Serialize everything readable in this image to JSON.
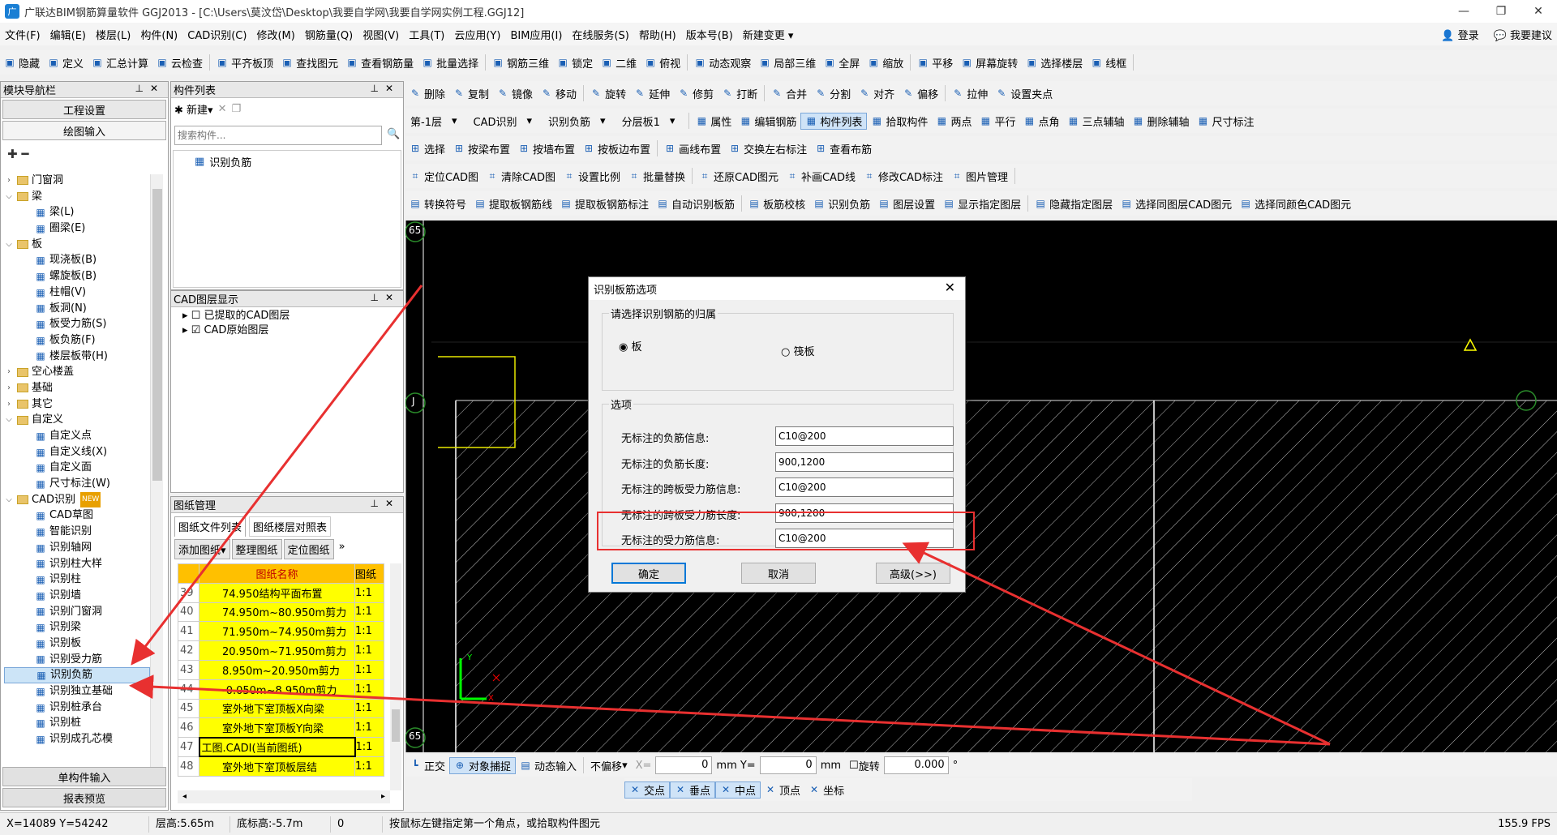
{
  "window": {
    "title": "广联达BIM钢筋算量软件 GGJ2013 - [C:\\Users\\莫汶岱\\Desktop\\我要自学网\\我要自学网实例工程.GGJ12]",
    "min": "—",
    "max": "❐",
    "close": "✕",
    "app_icon": "logo-icon"
  },
  "menu": {
    "items": [
      "文件(F)",
      "编辑(E)",
      "楼层(L)",
      "构件(N)",
      "CAD识别(C)",
      "修改(M)",
      "钢筋量(Q)",
      "视图(V)",
      "工具(T)",
      "云应用(Y)",
      "BIM应用(I)",
      "在线服务(S)",
      "帮助(H)",
      "版本号(B)",
      "新建变更 ▾"
    ],
    "login": "登录",
    "suggest": "我要建议"
  },
  "toolbar1": [
    "隐藏",
    "定义",
    "汇总计算",
    "云检查",
    "平齐板顶",
    "查找图元",
    "查看钢筋量",
    "批量选择",
    "钢筋三维",
    "锁定",
    "二维",
    "俯视",
    "动态观察",
    "局部三维",
    "全屏",
    "缩放",
    "平移",
    "屏幕旋转",
    "选择楼层",
    "线框"
  ],
  "toolbar2": [
    "删除",
    "复制",
    "镜像",
    "移动",
    "旋转",
    "延伸",
    "修剪",
    "打断",
    "合并",
    "分割",
    "对齐",
    "偏移",
    "拉伸",
    "设置夹点"
  ],
  "toolbar3": {
    "floor": "第-1层",
    "type": "CAD识别",
    "comp": "识别负筋",
    "layer": "分层板1",
    "items": [
      "属性",
      "编辑钢筋",
      "构件列表",
      "拾取构件",
      "两点",
      "平行",
      "点角",
      "三点辅轴",
      "删除辅轴",
      "尺寸标注"
    ]
  },
  "toolbar4": [
    "选择",
    "按梁布置",
    "按墙布置",
    "按板边布置",
    "画线布置",
    "交换左右标注",
    "查看布筋"
  ],
  "toolbar5": [
    "定位CAD图",
    "清除CAD图",
    "设置比例",
    "批量替换",
    "还原CAD图元",
    "补画CAD线",
    "修改CAD标注",
    "图片管理"
  ],
  "toolbar6": [
    "转换符号",
    "提取板钢筋线",
    "提取板钢筋标注",
    "自动识别板筋",
    "板筋校核",
    "识别负筋",
    "图层设置",
    "显示指定图层",
    "隐藏指定图层",
    "选择同图层CAD图元",
    "选择同颜色CAD图元"
  ],
  "nav": {
    "title": "模块导航栏",
    "btn1": "工程设置",
    "btn2": "绘图输入",
    "btn3": "单构件输入",
    "btn4": "报表预览",
    "tree": [
      {
        "l": "门窗洞",
        "lvl": 0,
        "f": true,
        "e": ">"
      },
      {
        "l": "梁",
        "lvl": 0,
        "f": true,
        "e": "v"
      },
      {
        "l": "梁(L)",
        "lvl": 1
      },
      {
        "l": "圈梁(E)",
        "lvl": 1
      },
      {
        "l": "板",
        "lvl": 0,
        "f": true,
        "e": "v"
      },
      {
        "l": "现浇板(B)",
        "lvl": 1
      },
      {
        "l": "螺旋板(B)",
        "lvl": 1
      },
      {
        "l": "柱帽(V)",
        "lvl": 1
      },
      {
        "l": "板洞(N)",
        "lvl": 1
      },
      {
        "l": "板受力筋(S)",
        "lvl": 1
      },
      {
        "l": "板负筋(F)",
        "lvl": 1
      },
      {
        "l": "楼层板带(H)",
        "lvl": 1
      },
      {
        "l": "空心楼盖",
        "lvl": 0,
        "f": true,
        "e": ">"
      },
      {
        "l": "基础",
        "lvl": 0,
        "f": true,
        "e": ">"
      },
      {
        "l": "其它",
        "lvl": 0,
        "f": true,
        "e": ">"
      },
      {
        "l": "自定义",
        "lvl": 0,
        "f": true,
        "e": "v"
      },
      {
        "l": "自定义点",
        "lvl": 1
      },
      {
        "l": "自定义线(X)",
        "lvl": 1
      },
      {
        "l": "自定义面",
        "lvl": 1
      },
      {
        "l": "尺寸标注(W)",
        "lvl": 1
      },
      {
        "l": "CAD识别",
        "lvl": 0,
        "f": true,
        "e": "v",
        "new": "NEW"
      },
      {
        "l": "CAD草图",
        "lvl": 1
      },
      {
        "l": "智能识别",
        "lvl": 1
      },
      {
        "l": "识别轴网",
        "lvl": 1
      },
      {
        "l": "识别柱大样",
        "lvl": 1
      },
      {
        "l": "识别柱",
        "lvl": 1
      },
      {
        "l": "识别墙",
        "lvl": 1
      },
      {
        "l": "识别门窗洞",
        "lvl": 1
      },
      {
        "l": "识别梁",
        "lvl": 1
      },
      {
        "l": "识别板",
        "lvl": 1
      },
      {
        "l": "识别受力筋",
        "lvl": 1
      },
      {
        "l": "识别负筋",
        "lvl": 1,
        "sel": true
      },
      {
        "l": "识别独立基础",
        "lvl": 1
      },
      {
        "l": "识别桩承台",
        "lvl": 1
      },
      {
        "l": "识别桩",
        "lvl": 1
      },
      {
        "l": "识别成孔芯模",
        "lvl": 1
      }
    ]
  },
  "complist": {
    "title": "构件列表",
    "new_btn": "新建",
    "search_ph": "搜索构件...",
    "item": "识别负筋"
  },
  "cadlayer": {
    "title": "CAD图层显示",
    "items": [
      "已提取的CAD图层",
      "CAD原始图层"
    ]
  },
  "drawings": {
    "title": "图纸管理",
    "tab1": "图纸文件列表",
    "tab2": "图纸楼层对照表",
    "btn1": "添加图纸",
    "btn2": "整理图纸",
    "btn3": "定位图纸",
    "col1": "图纸名称",
    "col2": "图纸",
    "rows": [
      [
        "39",
        "74.950结构平面布置",
        "1:1"
      ],
      [
        "40",
        "74.950m~80.950m剪力",
        "1:1"
      ],
      [
        "41",
        "71.950m~74.950m剪力",
        "1:1"
      ],
      [
        "42",
        "20.950m~71.950m剪力",
        "1:1"
      ],
      [
        "43",
        "8.950m~20.950m剪力",
        "1:1"
      ],
      [
        "44",
        "-0.050m~8.950m剪力",
        "1:1"
      ],
      [
        "45",
        "室外地下室顶板X向梁",
        "1:1"
      ],
      [
        "46",
        "室外地下室顶板Y向梁",
        "1:1"
      ],
      [
        "47",
        "工图.CADI(当前图纸)",
        "1:1"
      ],
      [
        "48",
        "室外地下室顶板层结",
        "1:1"
      ]
    ]
  },
  "canvas": {
    "label1": "65",
    "label2": "J",
    "label3": "65",
    "axis_y": "Y",
    "axis_x": "X"
  },
  "dialog": {
    "title": "识别板筋选项",
    "group1": "请选择识别钢筋的归属",
    "opt1": "板",
    "opt2": "筏板",
    "group2": "选项",
    "fields": [
      {
        "label": "无标注的负筋信息:",
        "value": "C10@200"
      },
      {
        "label": "无标注的负筋长度:",
        "value": "900,1200"
      },
      {
        "label": "无标注的跨板受力筋信息:",
        "value": "C10@200"
      },
      {
        "label": "无标注的跨板受力筋长度:",
        "value": "900,1200"
      },
      {
        "label": "无标注的受力筋信息:",
        "value": "C10@200"
      }
    ],
    "ok": "确定",
    "cancel": "取消",
    "adv": "高级(>>)"
  },
  "snapbar": {
    "items": [
      "正交",
      "对象捕捉",
      "动态输入"
    ],
    "offset": "不偏移",
    "x_label": "X=",
    "x_val": "0",
    "y_label": "mm Y=",
    "y_val": "0",
    "unit": "mm",
    "rotate": "旋转",
    "rot_val": "0.000",
    "deg": "°"
  },
  "snapbar2": [
    "交点",
    "垂点",
    "中点",
    "顶点",
    "坐标"
  ],
  "status": {
    "coords": "X=14089 Y=54242",
    "floor_h": "层高:5.65m",
    "base_h": "底标高:-5.7m",
    "zero": "0",
    "hint": "按鼠标左键指定第一个角点，或拾取构件图元",
    "fps": "155.9 FPS"
  },
  "colors": {
    "accent": "#0078d7",
    "highlight": "#ff0000",
    "row_yellow": "#ffff00",
    "header_orange": "#ffc000"
  }
}
